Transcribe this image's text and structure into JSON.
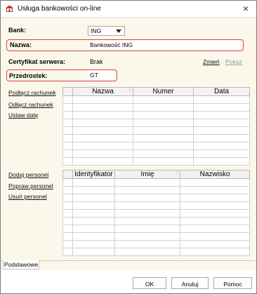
{
  "window": {
    "title": "Usługa bankowości on-line"
  },
  "form": {
    "bank_label": "Bank:",
    "bank_value": "ING",
    "nazwa_label": "Nazwa:",
    "nazwa_value": "Bankowość ING",
    "cert_label": "Certyfikat serwera:",
    "cert_value": "Brak",
    "cert_change_link": "Zmień",
    "cert_show_link": "Pokaż",
    "prefix_label": "Przedrostek:",
    "prefix_value": "GT"
  },
  "accounts": {
    "actions": [
      "Podłącz rachunek",
      "Odłącz rachunek",
      "Ustaw datę"
    ],
    "columns": [
      "Nazwa",
      "Numer",
      "Data"
    ]
  },
  "personnel": {
    "actions": [
      "Dodaj personel",
      "Popraw personel",
      "Usuń personel"
    ],
    "columns": [
      "Identyfikator",
      "Imię",
      "Nazwisko"
    ]
  },
  "tabs": [
    "Podstawowe"
  ],
  "buttons": {
    "ok": "OK",
    "cancel": "Anuluj",
    "help": "Pomoc"
  },
  "colors": {
    "highlight": "#e0404a",
    "background": "#fbf7ea"
  }
}
